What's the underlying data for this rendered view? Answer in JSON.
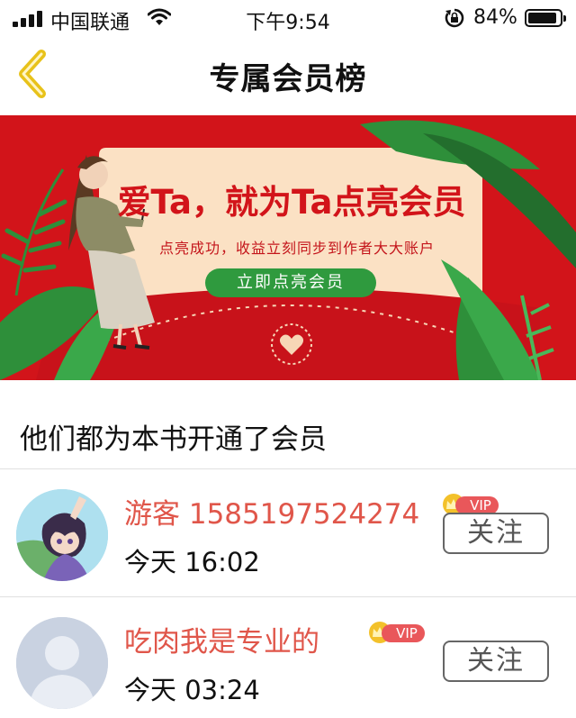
{
  "status_bar": {
    "carrier": "中国联通",
    "time": "下午9:54",
    "battery_text": "84%",
    "battery_level": 0.84
  },
  "nav": {
    "title": "专属会员榜",
    "back_icon": "chevron-left-icon"
  },
  "banner": {
    "headline": "爱Ta，就为Ta点亮会员",
    "subline": "点亮成功，收益立刻同步到作者大大账户",
    "cta_label": "立即点亮会员",
    "accent_red": "#d2141a",
    "accent_green": "#2f9a3e"
  },
  "section": {
    "heading": "他们都为本书开通了会员"
  },
  "members": [
    {
      "name": "游客 1585197524274",
      "vip_label": "VIP",
      "time": "今天 16:02",
      "follow_label": "关注",
      "avatar": "anime-avatar"
    },
    {
      "name": "吃肉我是专业的",
      "vip_label": "VIP",
      "time": "今天 03:24",
      "follow_label": "关注",
      "avatar": "default-person-avatar"
    }
  ],
  "colors": {
    "name_color": "#e0564a",
    "vip_color": "#e9575a"
  }
}
